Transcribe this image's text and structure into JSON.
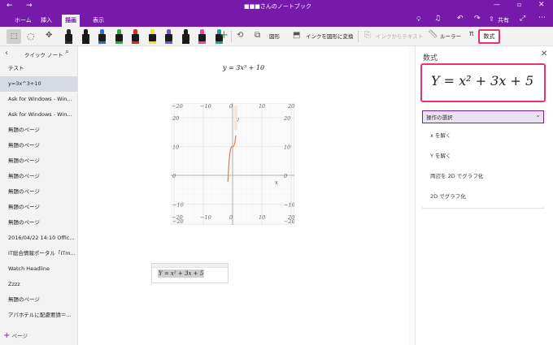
{
  "titlebar": {
    "title": "■■■さんのノートブック",
    "share_label": "共有"
  },
  "tabs": [
    {
      "label": "ホーム"
    },
    {
      "label": "挿入"
    },
    {
      "label": "描画"
    },
    {
      "label": "表示"
    }
  ],
  "toolbar": {
    "shapes_label": "図形",
    "ink_to_shape_label": "インクを図形に変換",
    "ink_to_text_label": "インクからテキスト",
    "ruler_label": "ルーラー",
    "math_label": "数式",
    "pen_colors": [
      "#2b2b2b",
      "#1a1a1a",
      "#2f6fd6",
      "#2ea84a",
      "#d92b2b",
      "#f2e12b",
      "#7a4fd6",
      "#1a1a1a",
      "#e84ca0",
      "#1ea3a3"
    ]
  },
  "sidebar": {
    "header": "クイック ノート",
    "items": [
      {
        "label": "テスト"
      },
      {
        "label": "y=3x^3+10"
      },
      {
        "label": "Ask for Windows - Win..."
      },
      {
        "label": "Ask for Windows - Win..."
      },
      {
        "label": "無題のページ"
      },
      {
        "label": "無題のページ"
      },
      {
        "label": "無題のページ"
      },
      {
        "label": "無題のページ"
      },
      {
        "label": "無題のページ"
      },
      {
        "label": "無題のページ"
      },
      {
        "label": "無題のページ"
      },
      {
        "label": "2016/04/22 14:10 Offic..."
      },
      {
        "label": "IT総合情報ポータル「ITm..."
      },
      {
        "label": "Watch Headline"
      },
      {
        "label": "Zzzz"
      },
      {
        "label": "無題のページ"
      },
      {
        "label": "アパホテルに配慮要請＝..."
      }
    ],
    "selected_index": 1,
    "add_page_label": "ページ"
  },
  "canvas": {
    "equation_top": "y = 3x³ + 10",
    "equation_box": "Y = x² + 3x + 5",
    "graph": {
      "tick_labels_x": [
        "−20",
        "−10",
        "0",
        "10",
        "20"
      ],
      "tick_labels_y": [
        "20",
        "10",
        "0",
        "−10",
        "−20"
      ],
      "x_axis_label": "x",
      "y_axis_label": "y"
    }
  },
  "math_panel": {
    "title": "数式",
    "equation": "Y = x² + 3x + 5",
    "dropdown_label": "操作の選択",
    "options": [
      {
        "label": "x を解く"
      },
      {
        "label": "Y を解く"
      },
      {
        "label": "両辺を 2D でグラフ化"
      },
      {
        "label": "2D でグラフ化"
      }
    ]
  },
  "colors": {
    "accent": "#7719aa",
    "highlight": "#e8336d",
    "curve": "#c9865b"
  }
}
